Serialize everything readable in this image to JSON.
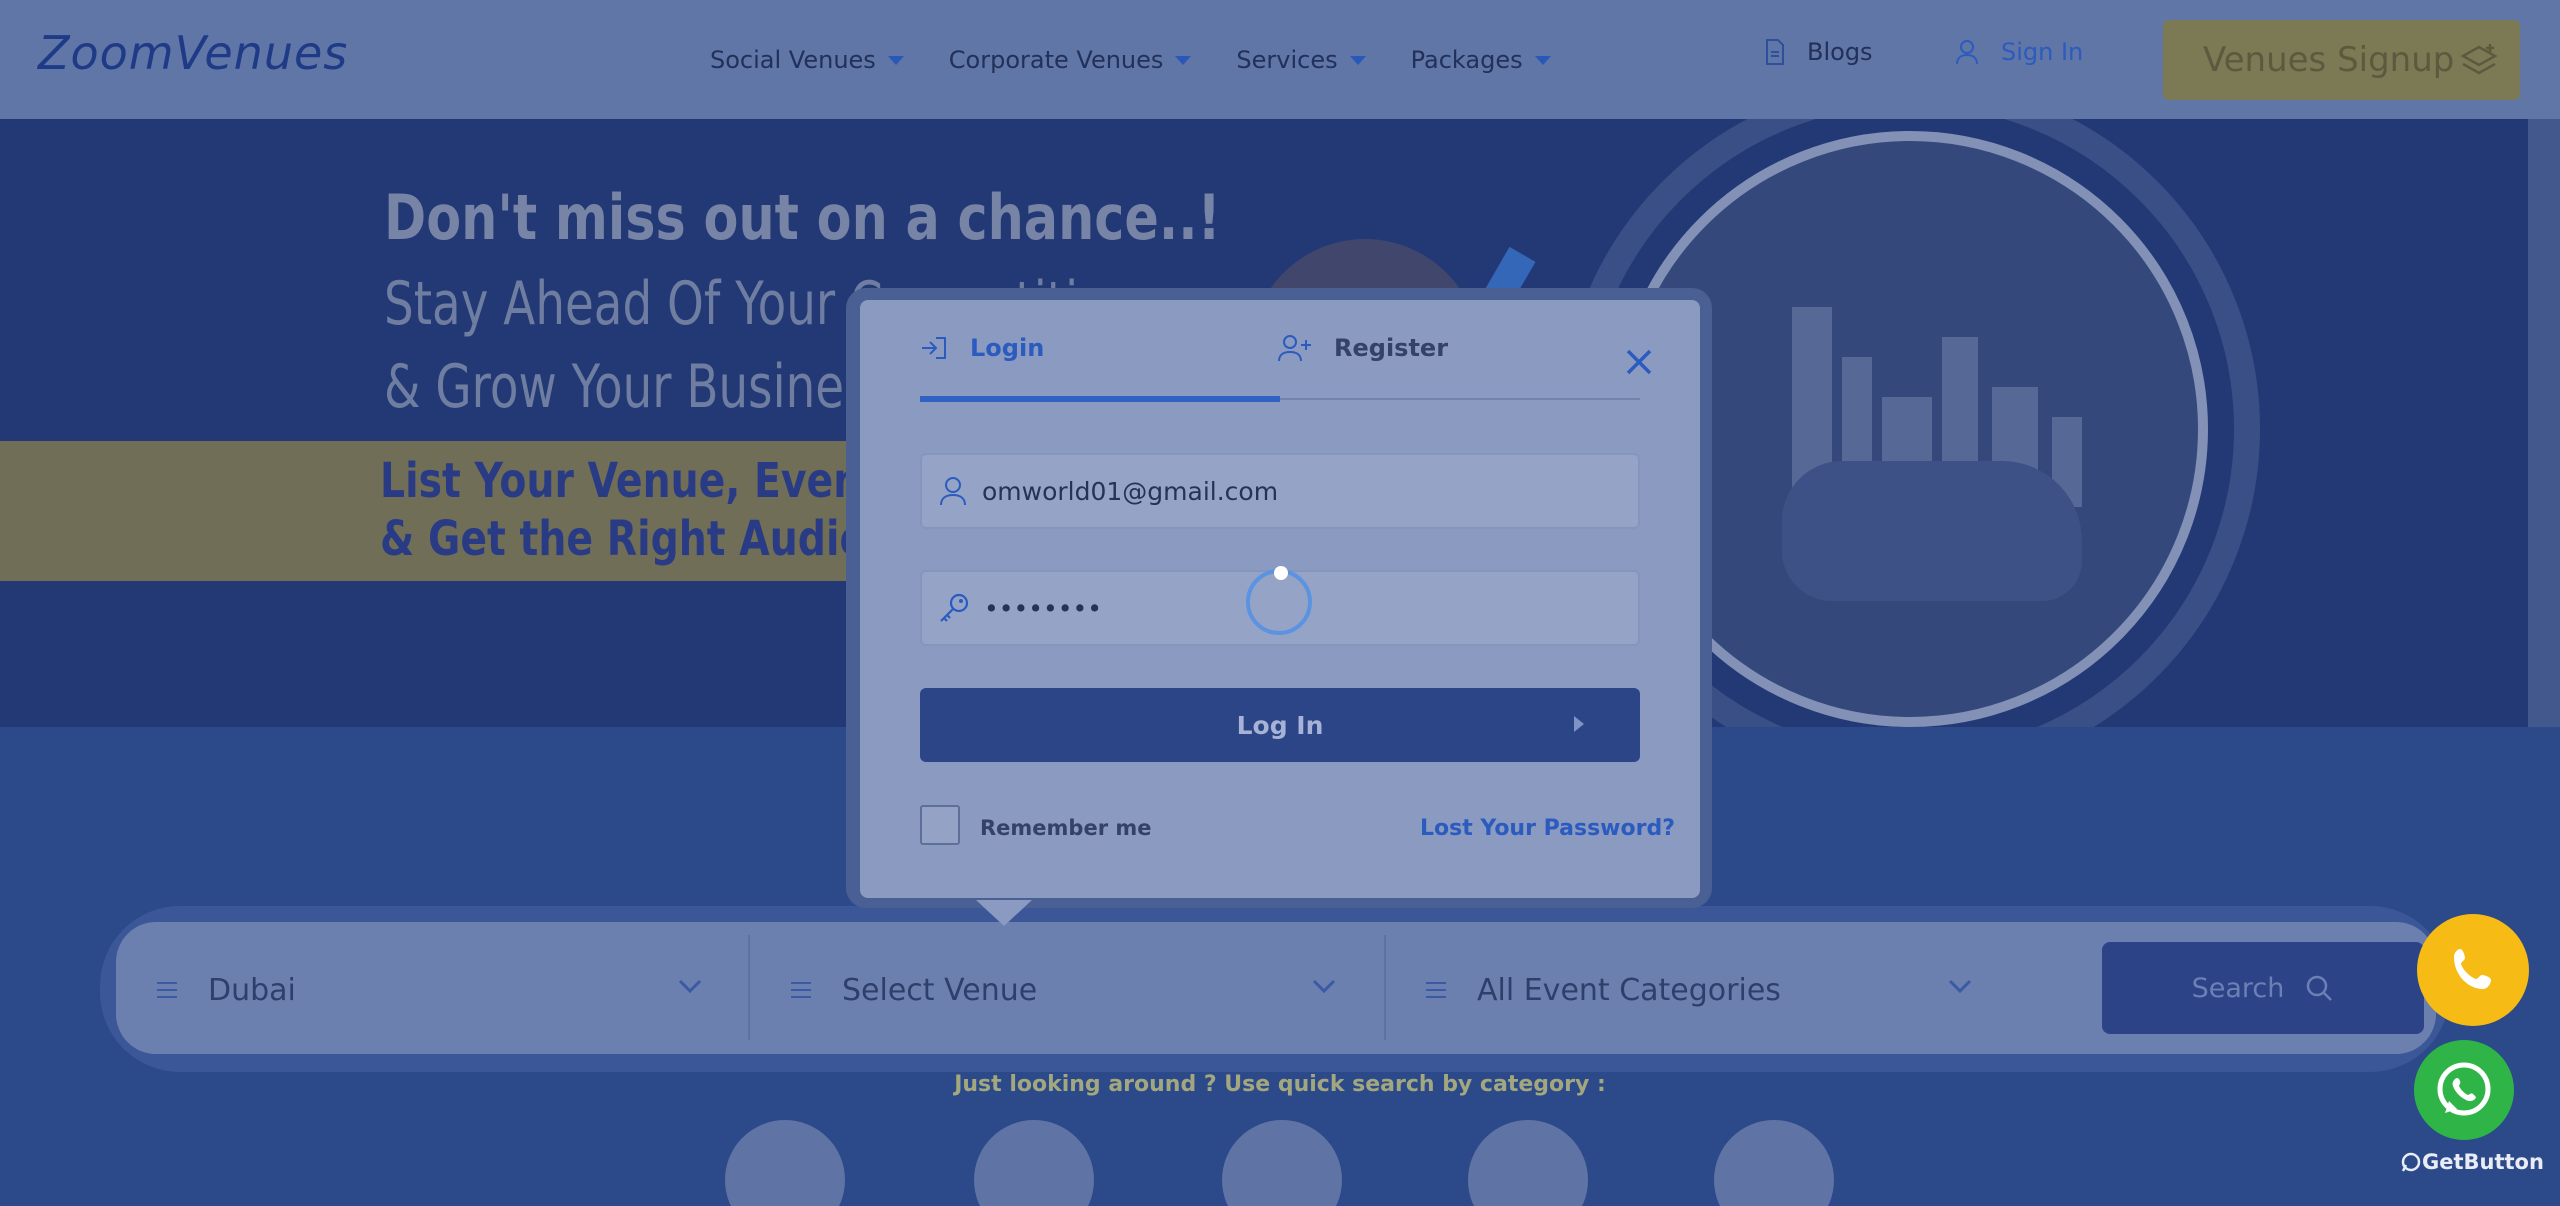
{
  "header": {
    "logo_text": "ZoomVenues",
    "nav": [
      {
        "label": "Social Venues"
      },
      {
        "label": "Corporate Venues"
      },
      {
        "label": "Services"
      },
      {
        "label": "Packages"
      }
    ],
    "blogs_label": "Blogs",
    "signin_label": "Sign In",
    "signup_label": "Venues Signup"
  },
  "hero": {
    "title": "Don't miss out on a chance..!",
    "line1": "Stay Ahead Of Your Competition",
    "line2": "& Grow Your Business",
    "list1": "List Your Venue, Event",
    "list2": "& Get the Right Audience"
  },
  "search": {
    "city": "Dubai",
    "venue": "Select Venue",
    "category": "All Event Categories",
    "button": "Search",
    "quick_label": "Just looking around ? Use quick search by category :"
  },
  "modal": {
    "tab_login": "Login",
    "tab_register": "Register",
    "username_value": "omworld01@gmail.com",
    "password_value": "••••••••",
    "login_button": "Log In",
    "remember_label": "Remember me",
    "lost_password": "Lost Your Password?"
  },
  "floating": {
    "getbutton_label": "GetButton"
  },
  "colors": {
    "accent": "#2f62c3",
    "phone_button": "#f6bb14",
    "whatsapp_button": "#2fb547"
  }
}
